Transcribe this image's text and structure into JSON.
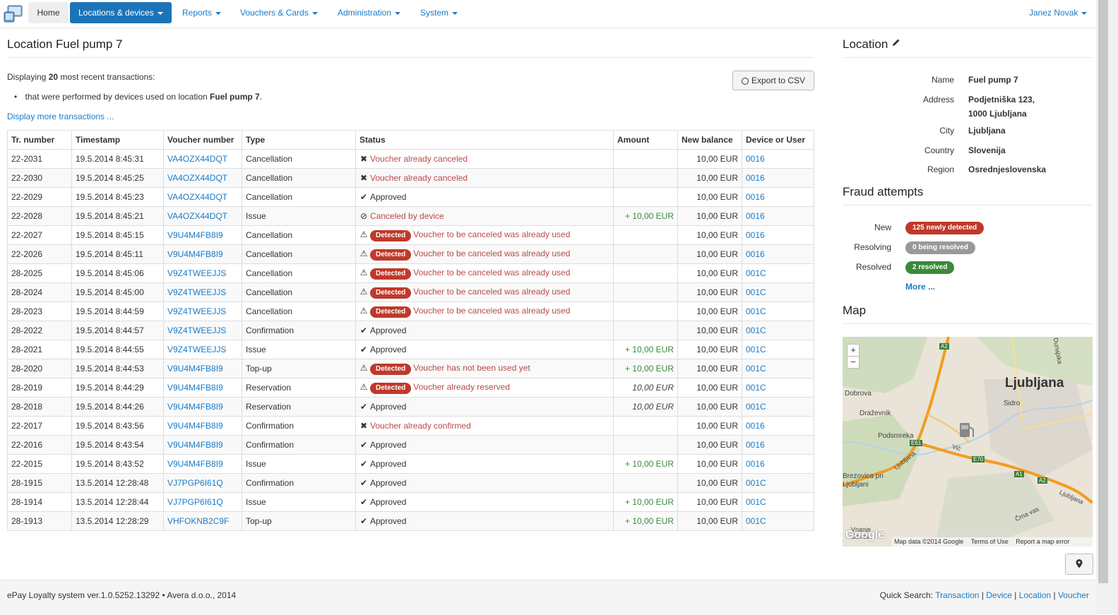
{
  "navbar": {
    "home": "Home",
    "locations": "Locations & devices",
    "reports": "Reports",
    "vouchers": "Vouchers & Cards",
    "administration": "Administration",
    "system": "System",
    "user": "Janez Novak"
  },
  "page": {
    "title": "Location Fuel pump 7",
    "displaying_prefix": "Displaying",
    "displaying_count": "20",
    "displaying_suffix": "most recent transactions:",
    "bullet_prefix": "that were performed by devices used on location",
    "bullet_location": "Fuel pump 7",
    "bullet_suffix": ".",
    "more_link": "Display more transactions ...",
    "export_label": "Export to CSV"
  },
  "table": {
    "headers": [
      "Tr. number",
      "Timestamp",
      "Voucher number",
      "Type",
      "Status",
      "Amount",
      "New balance",
      "Device or User"
    ],
    "rows": [
      {
        "tr": "22-2031",
        "ts": "19.5.2014 8:45:31",
        "voucher": "VA4OZX44DQT",
        "type": "Cancellation",
        "icon": "x",
        "badge": "",
        "status": "Voucher already canceled",
        "status_kind": "err",
        "amount": "",
        "amount_kind": "",
        "balance": "10,00 EUR",
        "device": "0016"
      },
      {
        "tr": "22-2030",
        "ts": "19.5.2014 8:45:25",
        "voucher": "VA4OZX44DQT",
        "type": "Cancellation",
        "icon": "x",
        "badge": "",
        "status": "Voucher already canceled",
        "status_kind": "err",
        "amount": "",
        "amount_kind": "",
        "balance": "10,00 EUR",
        "device": "0016"
      },
      {
        "tr": "22-2029",
        "ts": "19.5.2014 8:45:23",
        "voucher": "VA4OZX44DQT",
        "type": "Cancellation",
        "icon": "check",
        "badge": "",
        "status": "Approved",
        "status_kind": "ok",
        "amount": "",
        "amount_kind": "",
        "balance": "10,00 EUR",
        "device": "0016"
      },
      {
        "tr": "22-2028",
        "ts": "19.5.2014 8:45:21",
        "voucher": "VA4OZX44DQT",
        "type": "Issue",
        "icon": "ban",
        "badge": "",
        "status": "Canceled by device",
        "status_kind": "err",
        "amount": "+ 10,00 EUR",
        "amount_kind": "pos",
        "balance": "10,00 EUR",
        "device": "0016"
      },
      {
        "tr": "22-2027",
        "ts": "19.5.2014 8:45:15",
        "voucher": "V9U4M4FB8I9",
        "type": "Cancellation",
        "icon": "warn",
        "badge": "Detected",
        "status": "Voucher to be canceled was already used",
        "status_kind": "err",
        "amount": "",
        "amount_kind": "",
        "balance": "10,00 EUR",
        "device": "0016"
      },
      {
        "tr": "22-2026",
        "ts": "19.5.2014 8:45:11",
        "voucher": "V9U4M4FB8I9",
        "type": "Cancellation",
        "icon": "warn",
        "badge": "Detected",
        "status": "Voucher to be canceled was already used",
        "status_kind": "err",
        "amount": "",
        "amount_kind": "",
        "balance": "10,00 EUR",
        "device": "0016"
      },
      {
        "tr": "28-2025",
        "ts": "19.5.2014 8:45:06",
        "voucher": "V9Z4TWEEJJS",
        "type": "Cancellation",
        "icon": "warn",
        "badge": "Detected",
        "status": "Voucher to be canceled was already used",
        "status_kind": "err",
        "amount": "",
        "amount_kind": "",
        "balance": "10,00 EUR",
        "device": "001C"
      },
      {
        "tr": "28-2024",
        "ts": "19.5.2014 8:45:00",
        "voucher": "V9Z4TWEEJJS",
        "type": "Cancellation",
        "icon": "warn",
        "badge": "Detected",
        "status": "Voucher to be canceled was already used",
        "status_kind": "err",
        "amount": "",
        "amount_kind": "",
        "balance": "10,00 EUR",
        "device": "001C"
      },
      {
        "tr": "28-2023",
        "ts": "19.5.2014 8:44:59",
        "voucher": "V9Z4TWEEJJS",
        "type": "Cancellation",
        "icon": "warn",
        "badge": "Detected",
        "status": "Voucher to be canceled was already used",
        "status_kind": "err",
        "amount": "",
        "amount_kind": "",
        "balance": "10,00 EUR",
        "device": "001C"
      },
      {
        "tr": "28-2022",
        "ts": "19.5.2014 8:44:57",
        "voucher": "V9Z4TWEEJJS",
        "type": "Confirmation",
        "icon": "check",
        "badge": "",
        "status": "Approved",
        "status_kind": "ok",
        "amount": "",
        "amount_kind": "",
        "balance": "10,00 EUR",
        "device": "001C"
      },
      {
        "tr": "28-2021",
        "ts": "19.5.2014 8:44:55",
        "voucher": "V9Z4TWEEJJS",
        "type": "Issue",
        "icon": "check",
        "badge": "",
        "status": "Approved",
        "status_kind": "ok",
        "amount": "+ 10,00 EUR",
        "amount_kind": "pos",
        "balance": "10,00 EUR",
        "device": "001C"
      },
      {
        "tr": "28-2020",
        "ts": "19.5.2014 8:44:53",
        "voucher": "V9U4M4FB8I9",
        "type": "Top-up",
        "icon": "warn",
        "badge": "Detected",
        "status": "Voucher has not been used yet",
        "status_kind": "err",
        "amount": "+ 10,00 EUR",
        "amount_kind": "pos",
        "balance": "10,00 EUR",
        "device": "001C"
      },
      {
        "tr": "28-2019",
        "ts": "19.5.2014 8:44:29",
        "voucher": "V9U4M4FB8I9",
        "type": "Reservation",
        "icon": "warn",
        "badge": "Detected",
        "status": "Voucher already reserved",
        "status_kind": "err",
        "amount": "10,00 EUR",
        "amount_kind": "ital",
        "balance": "10,00 EUR",
        "device": "001C"
      },
      {
        "tr": "28-2018",
        "ts": "19.5.2014 8:44:26",
        "voucher": "V9U4M4FB8I9",
        "type": "Reservation",
        "icon": "check",
        "badge": "",
        "status": "Approved",
        "status_kind": "ok",
        "amount": "10,00 EUR",
        "amount_kind": "ital",
        "balance": "10,00 EUR",
        "device": "001C"
      },
      {
        "tr": "22-2017",
        "ts": "19.5.2014 8:43:56",
        "voucher": "V9U4M4FB8I9",
        "type": "Confirmation",
        "icon": "x",
        "badge": "",
        "status": "Voucher already confirmed",
        "status_kind": "err",
        "amount": "",
        "amount_kind": "",
        "balance": "10,00 EUR",
        "device": "0016"
      },
      {
        "tr": "22-2016",
        "ts": "19.5.2014 8:43:54",
        "voucher": "V9U4M4FB8I9",
        "type": "Confirmation",
        "icon": "check",
        "badge": "",
        "status": "Approved",
        "status_kind": "ok",
        "amount": "",
        "amount_kind": "",
        "balance": "10,00 EUR",
        "device": "0016"
      },
      {
        "tr": "22-2015",
        "ts": "19.5.2014 8:43:52",
        "voucher": "V9U4M4FB8I9",
        "type": "Issue",
        "icon": "check",
        "badge": "",
        "status": "Approved",
        "status_kind": "ok",
        "amount": "+ 10,00 EUR",
        "amount_kind": "pos",
        "balance": "10,00 EUR",
        "device": "0016"
      },
      {
        "tr": "28-1915",
        "ts": "13.5.2014 12:28:48",
        "voucher": "VJ7PGP6I61Q",
        "type": "Confirmation",
        "icon": "check",
        "badge": "",
        "status": "Approved",
        "status_kind": "ok",
        "amount": "",
        "amount_kind": "",
        "balance": "10,00 EUR",
        "device": "001C"
      },
      {
        "tr": "28-1914",
        "ts": "13.5.2014 12:28:44",
        "voucher": "VJ7PGP6I61Q",
        "type": "Issue",
        "icon": "check",
        "badge": "",
        "status": "Approved",
        "status_kind": "ok",
        "amount": "+ 10,00 EUR",
        "amount_kind": "pos",
        "balance": "10,00 EUR",
        "device": "001C"
      },
      {
        "tr": "28-1913",
        "ts": "13.5.2014 12:28:29",
        "voucher": "VHFOKNB2C9F",
        "type": "Top-up",
        "icon": "check",
        "badge": "",
        "status": "Approved",
        "status_kind": "ok",
        "amount": "+ 10,00 EUR",
        "amount_kind": "pos",
        "balance": "10,00 EUR",
        "device": "001C"
      }
    ]
  },
  "location": {
    "title": "Location",
    "name_label": "Name",
    "name": "Fuel pump 7",
    "address_label": "Address",
    "address_line1": "Podjetniška 123,",
    "address_line2": "1000 Ljubljana",
    "city_label": "City",
    "city": "Ljubljana",
    "country_label": "Country",
    "country": "Slovenija",
    "region_label": "Region",
    "region": "Osrednjeslovenska"
  },
  "fraud": {
    "title": "Fraud attempts",
    "new_label": "New",
    "new_badge": "125 newly detected",
    "resolving_label": "Resolving",
    "resolving_badge": "0 being resolved",
    "resolved_label": "Resolved",
    "resolved_badge": "2 resolved",
    "more": "More ..."
  },
  "map": {
    "title": "Map",
    "city_label": "Ljubljana",
    "labels": [
      "Dobrova",
      "Draževnik",
      "Podsmreka",
      "Sidro",
      "Brezovica pri Ljubljani",
      "Vnanje Gorice",
      "Črna vas",
      "Dunajska",
      "Ljubljana",
      "Ljubljana",
      "Vič"
    ],
    "road_labels": [
      "A2",
      "E61",
      "E70",
      "A1",
      "A2"
    ],
    "zoom_in": "+",
    "zoom_out": "−",
    "attribution": "Map data ©2014 Google",
    "terms": "Terms of Use",
    "report": "Report a map error",
    "google": "Google"
  },
  "footer": {
    "left": "ePay Loyalty system ver.1.0.5252.13292 • Avera d.o.o., 2014",
    "quick_search": "Quick Search:",
    "links": [
      "Transaction",
      "Device",
      "Location",
      "Voucher"
    ],
    "sep": "|"
  },
  "colors": {
    "brand": "#1c74b8",
    "link": "#1a7bc8",
    "danger": "#c0392b",
    "success": "#3a8a3a",
    "muted": "#999999"
  }
}
